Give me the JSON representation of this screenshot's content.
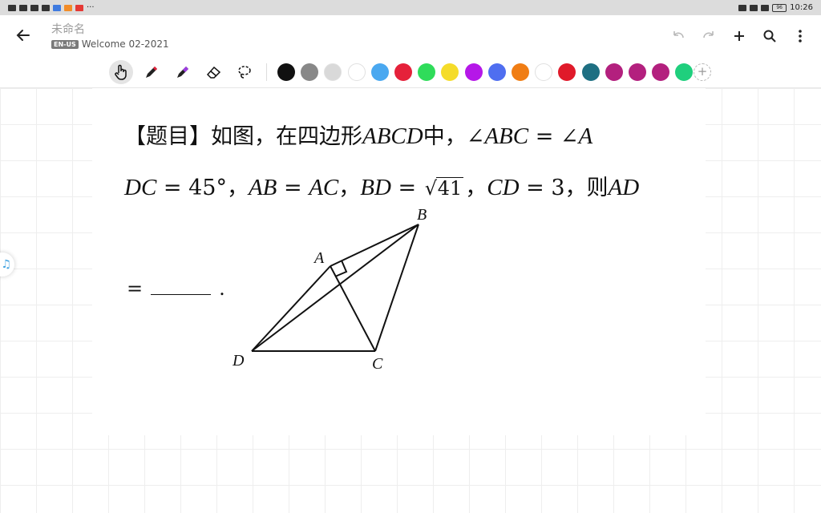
{
  "status": {
    "time": "10:26",
    "battery": "96"
  },
  "header": {
    "title": "未命名",
    "lang_badge": "EN-US",
    "subtitle": "Welcome 02-2021"
  },
  "toolbar": {
    "tools": [
      {
        "name": "hand-tool",
        "icon": "hand-icon",
        "active": true
      },
      {
        "name": "pen-tool",
        "icon": "pen-icon",
        "active": false
      },
      {
        "name": "highlighter-tool",
        "icon": "highlighter-icon",
        "active": false
      },
      {
        "name": "eraser-tool",
        "icon": "eraser-icon",
        "active": false
      },
      {
        "name": "lasso-tool",
        "icon": "lasso-icon",
        "active": false
      }
    ],
    "colors": [
      "#111111",
      "#888888",
      "#d9d9d9",
      "#ffffff",
      "#4aa8f0",
      "#e5213a",
      "#2fdc5a",
      "#f5dc2a",
      "#b517e8",
      "#4f6ef0",
      "#f07d14",
      "#ffffff",
      "#e01a2a",
      "#1e6f82",
      "#b3207e",
      "#b3207e",
      "#b3207e",
      "#1fcf7d"
    ],
    "add_label": "+"
  },
  "question": {
    "line1_a": "【题目】如图，在四边形",
    "line1_b": "ABCD",
    "line1_c": "中，∠",
    "line1_d": "ABC",
    "line1_e": " = ∠",
    "line1_f": "A",
    "line2_a": "DC",
    "line2_b": " = 45°，",
    "line2_c": "AB",
    "line2_d": " = ",
    "line2_e": "AC",
    "line2_f": "，",
    "line2_g": "BD",
    "line2_h": " = ",
    "sqrt_value": "41",
    "line2_i": "，",
    "line2_j": "CD",
    "line2_k": " = 3，则",
    "line2_l": "AD",
    "answer_prefix": "=",
    "answer_suffix": "."
  },
  "figure": {
    "labels": {
      "A": "A",
      "B": "B",
      "C": "C",
      "D": "D"
    }
  }
}
